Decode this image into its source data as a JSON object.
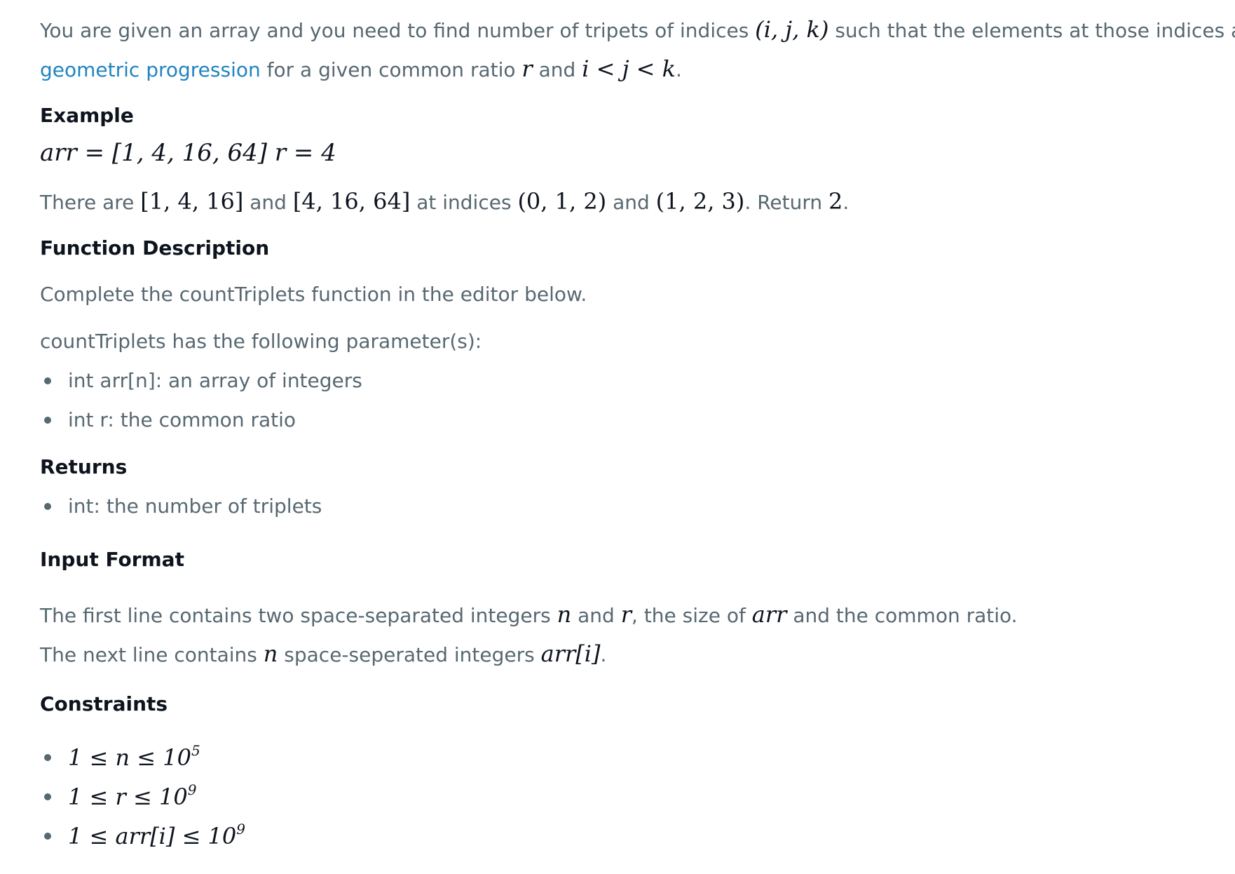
{
  "intro": {
    "text1": "You are given an array and you need to find number of tripets of indices ",
    "math1": "(i, j, k)",
    "text2": " such that the elements at those indices are in",
    "link": "geometric progression",
    "text3": " for a given common ratio ",
    "math_r": "r",
    "text4": " and ",
    "math_ijk": "i < j < k",
    "text5": "."
  },
  "example": {
    "heading": "Example",
    "math": "arr = [1, 4, 16, 64] r = 4",
    "text1": "There are ",
    "m1": "[1, 4, 16]",
    "text2": " and ",
    "m2": "[4, 16, 64]",
    "text3": " at indices ",
    "m3": "(0, 1, 2)",
    "text4": " and ",
    "m4": "(1, 2, 3)",
    "text5": ". Return ",
    "m5": "2",
    "text6": "."
  },
  "function_description": {
    "heading": "Function Description",
    "line1": "Complete the countTriplets function in the editor below.",
    "line2": "countTriplets has the following parameter(s):",
    "params": [
      "int arr[n]: an array of integers",
      "int r: the common ratio"
    ]
  },
  "returns": {
    "heading": "Returns",
    "items": [
      "int: the number of triplets"
    ]
  },
  "input_format": {
    "heading": "Input Format",
    "l1_t1": "The first line contains two space-separated integers ",
    "l1_m1": "n",
    "l1_t2": " and ",
    "l1_m2": "r",
    "l1_t3": ", the size of ",
    "l1_m3": "arr",
    "l1_t4": " and the common ratio.",
    "l2_t1": "The next line contains ",
    "l2_m1": "n",
    "l2_t2": " space-seperated integers ",
    "l2_m2": "arr[i]",
    "l2_t3": "."
  },
  "constraints": {
    "heading": "Constraints",
    "c1_base": "1 ≤ n ≤ 10",
    "c1_exp": "5",
    "c2_base": "1 ≤ r ≤ 10",
    "c2_exp": "9",
    "c3_base": "1 ≤ arr[i] ≤ 10",
    "c3_exp": "9"
  }
}
